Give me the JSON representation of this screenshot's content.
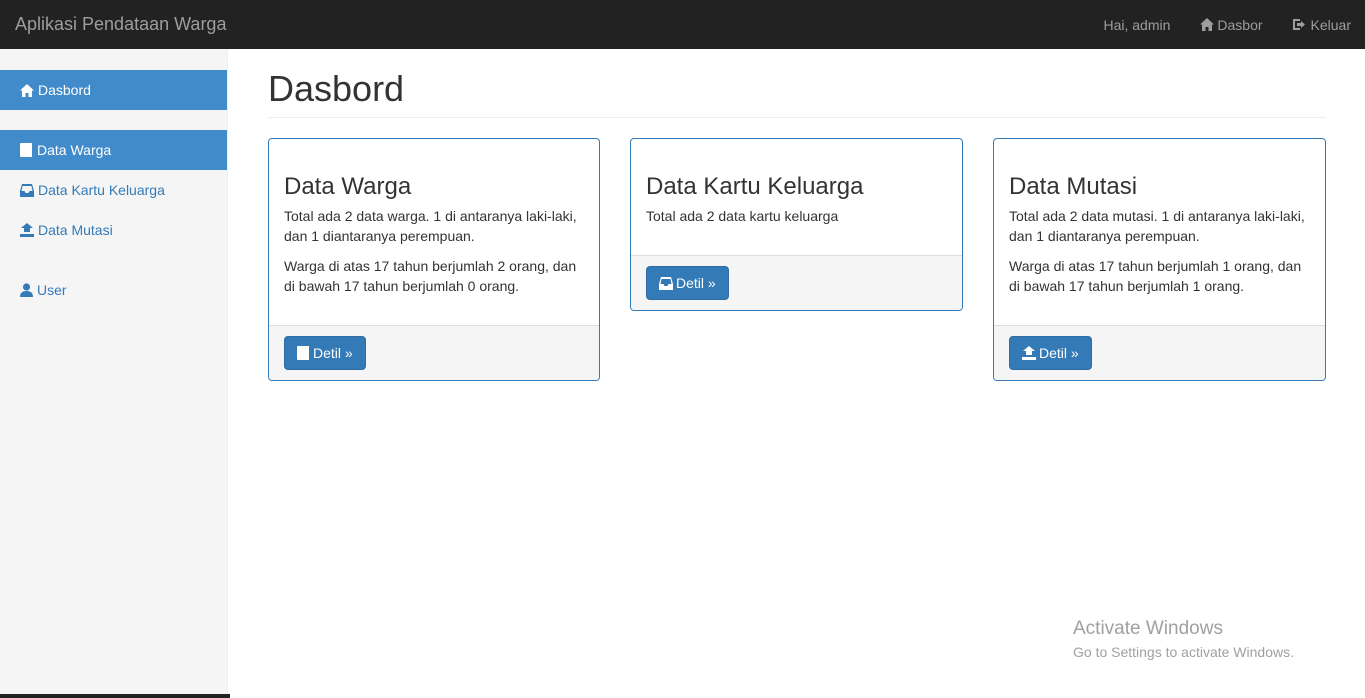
{
  "navbar": {
    "brand": "Aplikasi Pendataan Warga",
    "greeting": "Hai, admin",
    "dashboard_label": "Dasbor",
    "logout_label": "Keluar"
  },
  "sidebar": {
    "items": [
      {
        "label": "Dasbord",
        "icon": "home-icon",
        "active": true
      },
      {
        "label": "Data Warga",
        "icon": "book-icon",
        "active": true
      },
      {
        "label": "Data Kartu Keluarga",
        "icon": "inbox-icon",
        "active": false
      },
      {
        "label": "Data Mutasi",
        "icon": "transfer-icon",
        "active": false
      },
      {
        "label": "User",
        "icon": "user-icon",
        "active": false
      }
    ]
  },
  "main": {
    "title": "Dasbord",
    "panels": [
      {
        "title": "Data Warga",
        "text1": "Total ada 2 data warga. 1 di antaranya laki-laki, dan 1 diantaranya perempuan.",
        "text2": "Warga di atas 17 tahun berjumlah 2 orang, dan di bawah 17 tahun berjumlah 0 orang.",
        "button": "Detil »",
        "icon": "book-icon"
      },
      {
        "title": "Data Kartu Keluarga",
        "text1": "Total ada 2 data kartu keluarga",
        "button": "Detil »",
        "icon": "inbox-icon"
      },
      {
        "title": "Data Mutasi",
        "text1": "Total ada 2 data mutasi. 1 di antaranya laki-laki, dan 1 diantaranya perempuan.",
        "text2": "Warga di atas 17 tahun berjumlah 1 orang, dan di bawah 17 tahun berjumlah 1 orang.",
        "button": "Detil »",
        "icon": "transfer-icon"
      }
    ]
  },
  "watermark": {
    "title": "Activate Windows",
    "subtitle": "Go to Settings to activate Windows."
  },
  "colors": {
    "navbar": "#222222",
    "primary": "#337ab7",
    "sidebar_active": "#428bca",
    "sidebar_bg": "#f5f5f5"
  }
}
